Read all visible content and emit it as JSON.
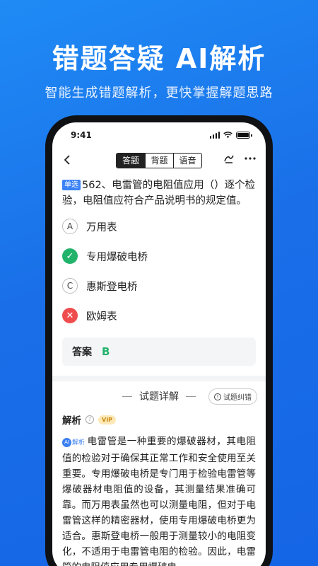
{
  "promo": {
    "title": "错题答疑 AI解析",
    "subtitle": "智能生成错题解析，更快掌握解题思路"
  },
  "status_bar": {
    "time": "9:41"
  },
  "nav": {
    "tabs": [
      {
        "label": "答题",
        "active": true
      },
      {
        "label": "背题",
        "active": false
      },
      {
        "label": "语音",
        "active": false
      }
    ]
  },
  "question": {
    "type_tag": "单选",
    "text": "562、电雷管的电阻值应用（）逐个检验，电阻值应符合产品说明书的规定值。"
  },
  "options": [
    {
      "mark": "A",
      "state": "plain",
      "text": "万用表"
    },
    {
      "mark": "✓",
      "state": "correct",
      "text": "专用爆破电桥"
    },
    {
      "mark": "C",
      "state": "plain",
      "text": "惠斯登电桥"
    },
    {
      "mark": "✕",
      "state": "wrong",
      "text": "欧姆表"
    }
  ],
  "answer": {
    "label": "答案",
    "value": "B"
  },
  "detail": {
    "title": "试题详解",
    "report_button": "试题纠错",
    "report_icon": "!",
    "analysis_label": "解析",
    "help_icon": "?",
    "vip_badge": "VIP",
    "ai_tag_icon": "AI",
    "ai_tag_label": "解析",
    "analysis_text": "电雷管是一种重要的爆破器材，其电阻值的检验对于确保其正常工作和安全使用至关重要。专用爆破电桥是专门用于检验电雷管等爆破器材电阻值的设备，其测量结果准确可靠。而万用表虽然也可以测量电阻，但对于电雷管这样的精密器材，使用专用爆破电桥更为适合。惠斯登电桥一般用于测量较小的电阻变化，不适用于电雷管电阻的检验。因此，电雷管的电阻值应用专用爆破电"
  },
  "colors": {
    "background": "#1a6fe8",
    "correct": "#22b36b",
    "wrong": "#ef4d4d",
    "tag_blue": "#3b82f6"
  },
  "icons": {
    "back": "chevron-left-icon",
    "pen": "pen-icon",
    "more": "more-icon"
  }
}
